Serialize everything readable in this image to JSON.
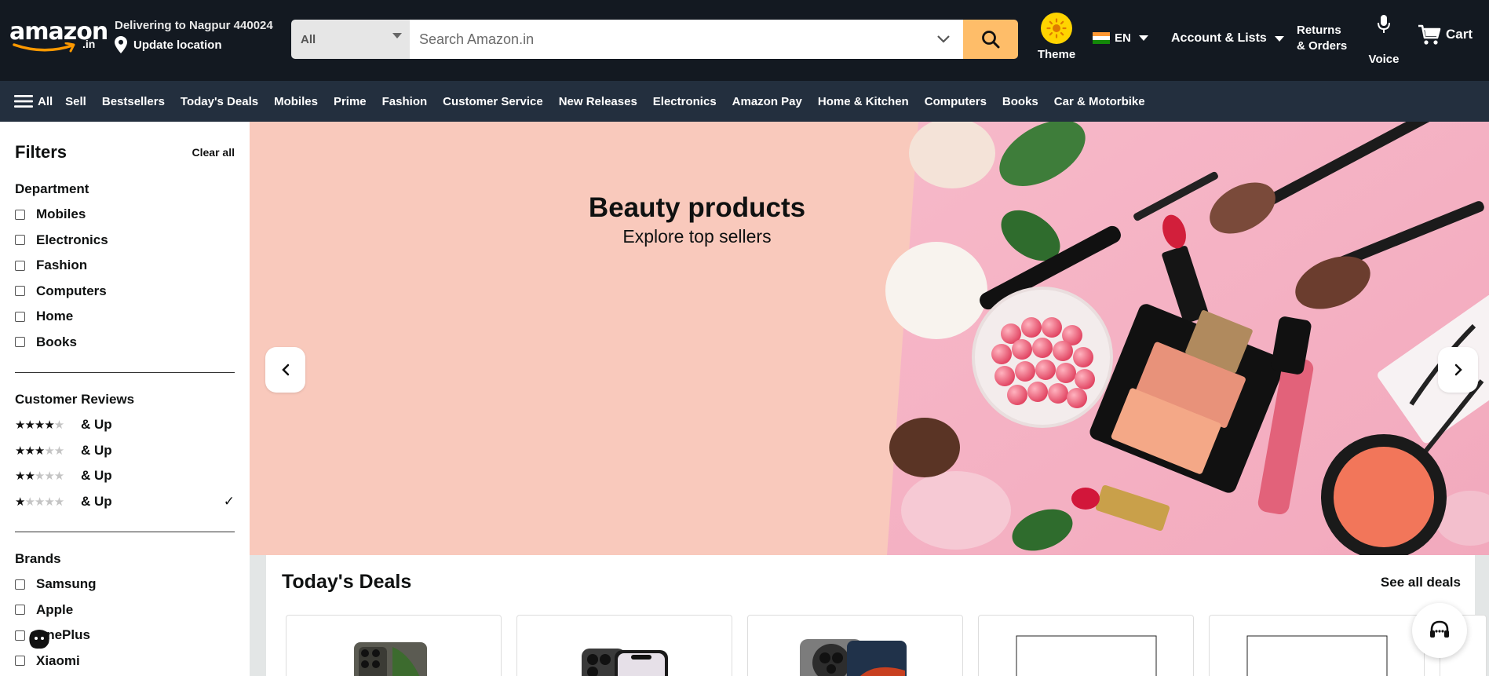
{
  "header": {
    "logo_text": "amazon",
    "logo_tld": ".in",
    "delivery_line": "Delivering to Nagpur 440024",
    "update_location": "Update location",
    "search_category": "All",
    "search_placeholder": "Search Amazon.in",
    "theme_label": "Theme",
    "language": "EN",
    "account": "Account & Lists",
    "returns_line1": "Returns",
    "returns_line2": "& Orders",
    "voice_label": "Voice",
    "cart_label": "Cart",
    "colors": {
      "header_bg": "#131921",
      "nav_bg": "#232f3e",
      "search_button": "#febd69",
      "theme_sun": "#ffd400"
    }
  },
  "nav": {
    "all_label": "All",
    "items": [
      "Sell",
      "Bestsellers",
      "Today's Deals",
      "Mobiles",
      "Prime",
      "Fashion",
      "Customer Service",
      "New Releases",
      "Electronics",
      "Amazon Pay",
      "Home & Kitchen",
      "Computers",
      "Books",
      "Car & Motorbike"
    ]
  },
  "filters": {
    "title": "Filters",
    "clear_all": "Clear all",
    "department_title": "Department",
    "departments": [
      "Mobiles",
      "Electronics",
      "Fashion",
      "Computers",
      "Home",
      "Books"
    ],
    "reviews_title": "Customer Reviews",
    "ratings": [
      {
        "stars": 4,
        "label": "& Up",
        "selected": false
      },
      {
        "stars": 3,
        "label": "& Up",
        "selected": false
      },
      {
        "stars": 2,
        "label": "& Up",
        "selected": false
      },
      {
        "stars": 1,
        "label": "& Up",
        "selected": true
      }
    ],
    "selected_mark": "✓",
    "brands_title": "Brands",
    "brands": [
      "Samsung",
      "Apple",
      "OnePlus",
      "Xiaomi"
    ]
  },
  "hero": {
    "title": "Beauty products",
    "subtitle": "Explore top sellers",
    "background": "#f9c9bc"
  },
  "deals": {
    "title": "Today's Deals",
    "see_all": "See all deals",
    "cards": [
      "phone-1",
      "phone-2",
      "phone-3",
      "blank-1",
      "blank-2"
    ]
  }
}
